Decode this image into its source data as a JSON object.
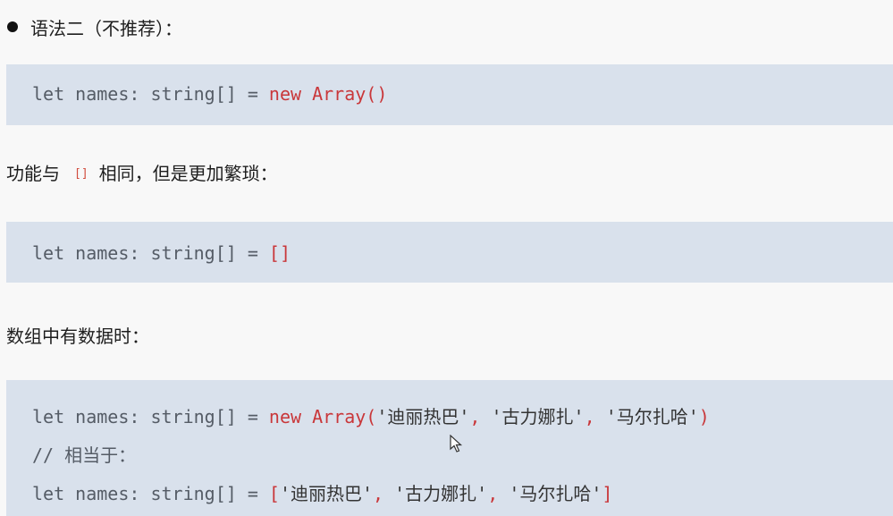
{
  "heading": {
    "text": "语法二（不推荐）："
  },
  "block1": {
    "prefix": "let names: string[] = ",
    "new_kw": "new",
    "space": " ",
    "array_call": "Array()"
  },
  "para1": {
    "before": "功能与",
    "inline_code": "[]",
    "after": "相同，但是更加繁琐："
  },
  "block2": {
    "prefix": "let names: string[] = ",
    "brackets": "[]"
  },
  "para2": {
    "text": "数组中有数据时："
  },
  "block3": {
    "line1_prefix": "let names: string[] = ",
    "line1_new": "new",
    "line1_space": " ",
    "line1_array_open": "Array(",
    "s1": "'迪丽热巴'",
    "comma": ", ",
    "s2": "'古力娜扎'",
    "s3": "'马尔扎哈'",
    "close_paren": ")",
    "comment": "// 相当于：",
    "line3_prefix": "let names: string[] = ",
    "open_bracket": "[",
    "close_bracket": "]"
  }
}
